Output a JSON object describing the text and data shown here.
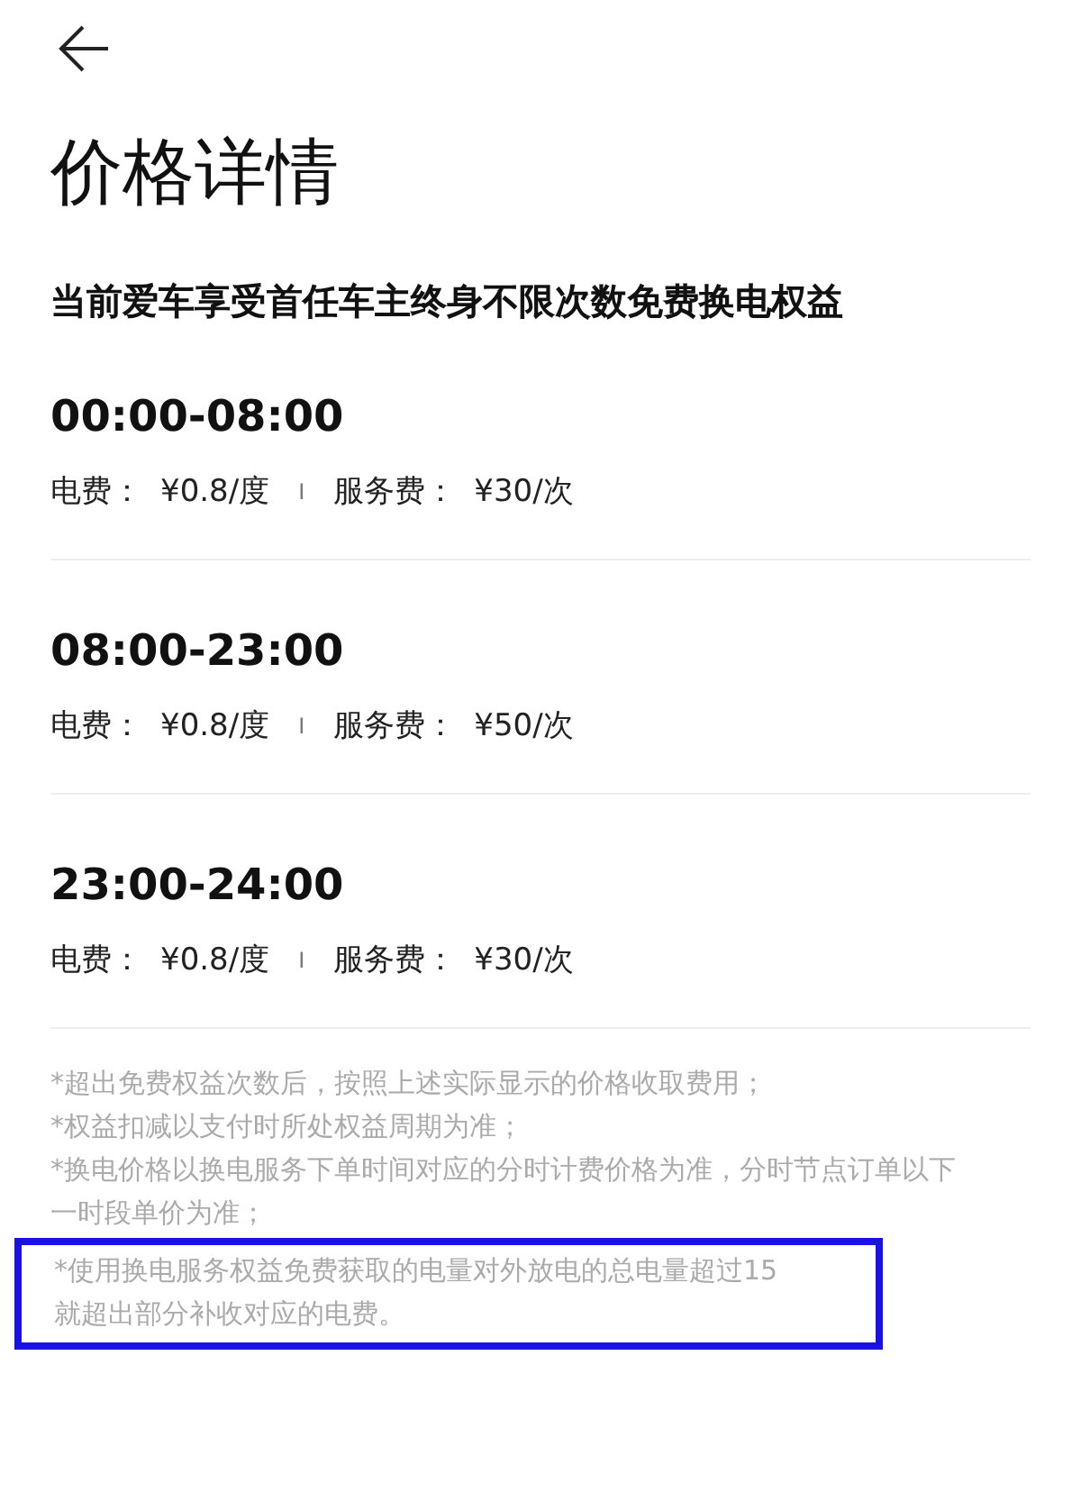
{
  "title": "价格详情",
  "subtitle": "当前爱车享受首任车主终身不限次数免费换电权益",
  "periods": [
    {
      "time": "00:00-08:00",
      "electricity_label": "电费：",
      "electricity_price": "¥0.8/度",
      "separator": "I",
      "service_label": "服务费：",
      "service_price": "¥30/次"
    },
    {
      "time": "08:00-23:00",
      "electricity_label": "电费：",
      "electricity_price": "¥0.8/度",
      "separator": "I",
      "service_label": "服务费：",
      "service_price": "¥50/次"
    },
    {
      "time": "23:00-24:00",
      "electricity_label": "电费：",
      "electricity_price": "¥0.8/度",
      "separator": "I",
      "service_label": "服务费：",
      "service_price": "¥30/次"
    }
  ],
  "notes": [
    {
      "text": "*超出免费权益次数后，按照上述实际显示的价格收取费用；",
      "highlighted": false
    },
    {
      "text": "*权益扣减以支付时所处权益周期为准；",
      "highlighted": false
    },
    {
      "text": "*换电价格以换电服务下单时间对应的分时计费价格为准，分时节点订单以下一时段单价为准；",
      "highlighted": false
    },
    {
      "text": "*使用换电服务权益免费获取的电量对外放电的总电量超过15\n就超出部分补收对应的电费。",
      "highlighted": true
    }
  ]
}
